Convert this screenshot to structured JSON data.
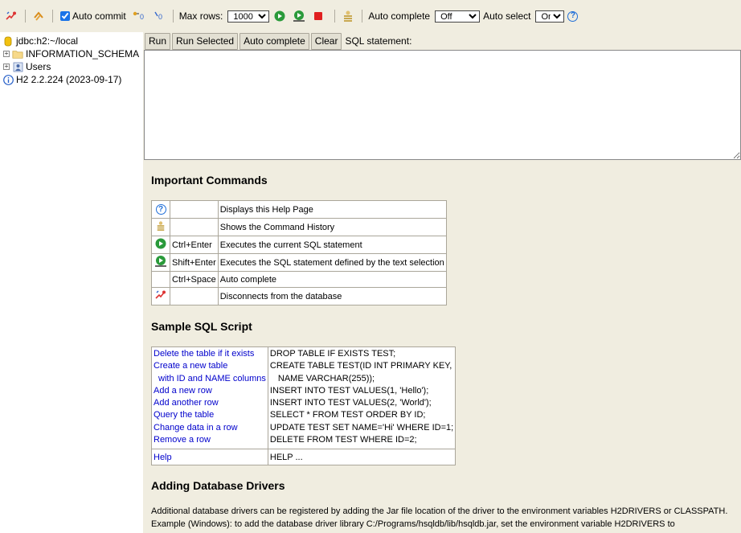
{
  "toolbar": {
    "auto_commit_label": "Auto commit",
    "max_rows_label": "Max rows:",
    "max_rows_value": "1000",
    "auto_complete_label": "Auto complete",
    "auto_complete_value": "Off",
    "auto_select_label": "Auto select",
    "auto_select_value": "On",
    "help_glyph": "?"
  },
  "tree": {
    "connection": "jdbc:h2:~/local",
    "items": [
      {
        "label": "INFORMATION_SCHEMA"
      },
      {
        "label": "Users"
      }
    ],
    "version": "H2 2.2.224 (2023-09-17)"
  },
  "buttons": {
    "run": "Run",
    "run_selected": "Run Selected",
    "auto_complete": "Auto complete",
    "clear": "Clear",
    "sql_label": "SQL statement:"
  },
  "important": {
    "title": "Important Commands",
    "rows": [
      {
        "icon": "help-icon",
        "key": "",
        "desc": "Displays this Help Page"
      },
      {
        "icon": "history-icon",
        "key": "",
        "desc": "Shows the Command History"
      },
      {
        "icon": "run-icon",
        "key": "Ctrl+Enter",
        "desc": "Executes the current SQL statement"
      },
      {
        "icon": "run-selected-icon",
        "key": "Shift+Enter",
        "desc": "Executes the SQL statement defined by the text selection"
      },
      {
        "icon": "",
        "key": "Ctrl+Space",
        "desc": "Auto complete"
      },
      {
        "icon": "disconnect-icon",
        "key": "",
        "desc": "Disconnects from the database"
      }
    ]
  },
  "sample": {
    "title": "Sample SQL Script",
    "left": [
      "Delete the table if it exists",
      "Create a new table",
      "with ID and NAME columns",
      "Add a new row",
      "Add another row",
      "Query the table",
      "Change data in a row",
      "Remove a row"
    ],
    "right": [
      "DROP TABLE IF EXISTS TEST;",
      "CREATE TABLE TEST(ID INT PRIMARY KEY,",
      "NAME VARCHAR(255));",
      "INSERT INTO TEST VALUES(1, 'Hello');",
      "INSERT INTO TEST VALUES(2, 'World');",
      "SELECT * FROM TEST ORDER BY ID;",
      "UPDATE TEST SET NAME='Hi' WHERE ID=1;",
      "DELETE FROM TEST WHERE ID=2;"
    ],
    "help_left": "Help",
    "help_right": "HELP ..."
  },
  "drivers": {
    "title": "Adding Database Drivers",
    "line1": "Additional database drivers can be registered by adding the Jar file location of the driver to the environment variables H2DRIVERS or CLASSPATH.",
    "line2": "Example (Windows): to add the database driver library C:/Programs/hsqldb/lib/hsqldb.jar, set the environment variable H2DRIVERS to"
  }
}
